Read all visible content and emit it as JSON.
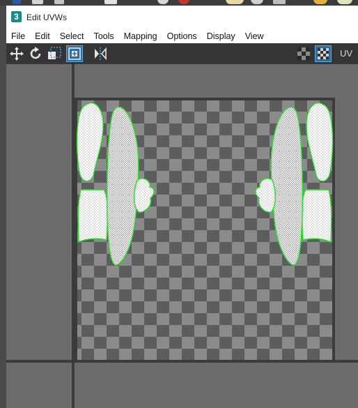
{
  "window": {
    "title": "Edit UVWs",
    "app_icon_text": "3"
  },
  "menu": [
    {
      "id": "file",
      "label": "File"
    },
    {
      "id": "edit",
      "label": "Edit"
    },
    {
      "id": "select",
      "label": "Select"
    },
    {
      "id": "tools",
      "label": "Tools"
    },
    {
      "id": "mapping",
      "label": "Mapping"
    },
    {
      "id": "options",
      "label": "Options"
    },
    {
      "id": "display",
      "label": "Display"
    },
    {
      "id": "view",
      "label": "View"
    }
  ],
  "toolbar": {
    "tools": [
      "move-icon",
      "rotate-icon",
      "freeform-icon",
      "scale-icon",
      "mirror-icon"
    ],
    "right_tools": [
      "checker-toggle-icon",
      "checker-map-icon"
    ],
    "uv_label": "UV"
  },
  "colors": {
    "accent": "#1d8a8a",
    "uv_edge": "#ffffff",
    "uv_border": "#22dd22",
    "checker_light": "#8c8c8c",
    "checker_dark": "#5c5c5c"
  }
}
